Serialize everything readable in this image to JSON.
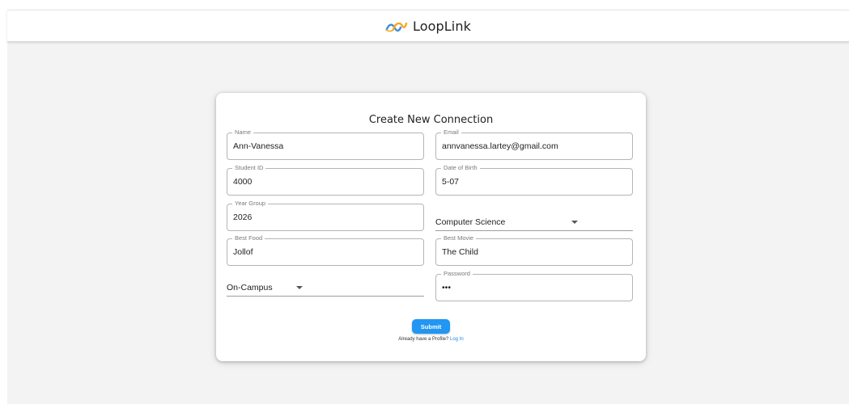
{
  "header": {
    "brand_name": "LoopLink",
    "logo_icon": "looplink-logo-icon"
  },
  "form": {
    "title": "Create New Connection",
    "fields": {
      "name": {
        "label": "Name",
        "value": "Ann-Vanessa"
      },
      "email": {
        "label": "Email",
        "value": "annvanessa.lartey@gmail.com"
      },
      "student_id": {
        "label": "Student ID",
        "value": "4000"
      },
      "dob": {
        "label": "Date of Birth",
        "value": "5-07"
      },
      "year_group": {
        "label": "Year Group",
        "value": "2026"
      },
      "major": {
        "value": "Computer Science"
      },
      "best_food": {
        "label": "Best Food",
        "value": "Jollof"
      },
      "best_movie": {
        "label": "Best Movie",
        "value": "The Child"
      },
      "residence": {
        "value": "On-Campus"
      },
      "password": {
        "label": "Password",
        "value": "•••"
      }
    },
    "submit_label": "Submit",
    "login_prompt": "Already have a Profile?",
    "login_link": "Log In"
  },
  "colors": {
    "accent": "#2196f3",
    "link": "#1e88e5",
    "background": "#f3f3f3",
    "logo_blue": "#3f8fd6",
    "logo_orange": "#f5a623"
  }
}
